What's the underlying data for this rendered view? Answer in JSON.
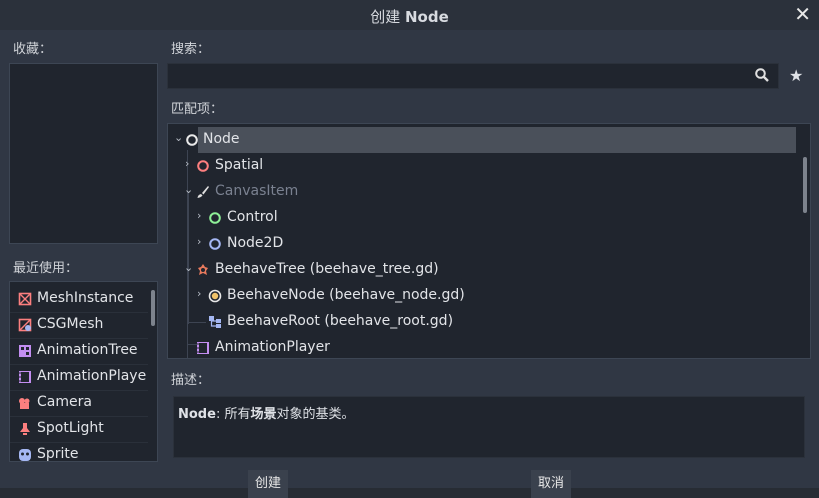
{
  "dialog": {
    "title_prefix": "创建 ",
    "title_bold": "Node",
    "close_label": "✕"
  },
  "favorites": {
    "label": "收藏："
  },
  "recent": {
    "label": "最近使用：",
    "items": [
      {
        "label": "MeshInstance",
        "icon": "mesh-instance-icon"
      },
      {
        "label": "CSGMesh",
        "icon": "csg-mesh-icon"
      },
      {
        "label": "AnimationTree",
        "icon": "animation-tree-icon"
      },
      {
        "label": "AnimationPlaye",
        "icon": "animation-player-icon"
      },
      {
        "label": "Camera",
        "icon": "camera-icon"
      },
      {
        "label": "SpotLight",
        "icon": "spotlight-icon"
      },
      {
        "label": "Sprite",
        "icon": "sprite-icon"
      }
    ]
  },
  "search": {
    "label": "搜索：",
    "value": "",
    "placeholder": ""
  },
  "matches": {
    "label": "匹配项：",
    "tree": [
      {
        "label": "Node",
        "icon": "node-circle-icon",
        "expanded": true,
        "selected": true
      },
      {
        "label": "Spatial",
        "icon": "spatial-circle-icon",
        "expanded": false
      },
      {
        "label": "CanvasItem",
        "icon": "brush-icon",
        "expanded": true,
        "disabled": true
      },
      {
        "label": "Control",
        "icon": "control-circle-icon",
        "expanded": false
      },
      {
        "label": "Node2D",
        "icon": "node2d-circle-icon",
        "expanded": false
      },
      {
        "label": "BeehaveTree (beehave_tree.gd)",
        "icon": "beehave-tree-icon",
        "expanded": true
      },
      {
        "label": "BeehaveNode (beehave_node.gd)",
        "icon": "beehave-node-icon",
        "expanded": false
      },
      {
        "label": "BeehaveRoot (beehave_root.gd)",
        "icon": "beehave-root-icon"
      },
      {
        "label": "AnimationPlayer",
        "icon": "animation-player-icon"
      }
    ]
  },
  "description": {
    "label": "描述：",
    "name_bold": "Node",
    "sep": ": 所有",
    "highlight": "场景",
    "rest": "对象的基类。"
  },
  "buttons": {
    "create": "创建",
    "cancel": "取消"
  },
  "colors": {
    "background": "#303744",
    "panel": "#20252e",
    "selection": "#4a505a",
    "node_icon": "#e8e8e8",
    "spatial_icon": "#fc7f7f",
    "control_icon": "#8eef97",
    "node2d_icon": "#a5b7f3"
  }
}
